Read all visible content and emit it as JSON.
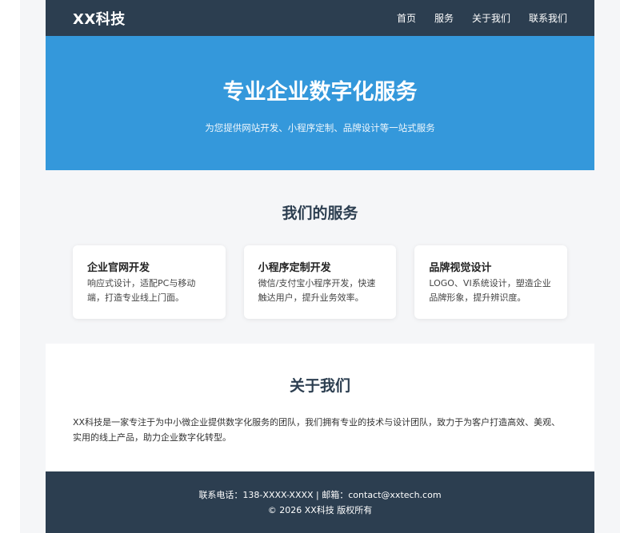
{
  "header": {
    "logo": "XX科技",
    "nav": [
      "首页",
      "服务",
      "关于我们",
      "联系我们"
    ]
  },
  "hero": {
    "title": "专业企业数字化服务",
    "subtitle": "为您提供网站开发、小程序定制、品牌设计等一站式服务"
  },
  "services": {
    "title": "我们的服务",
    "cards": [
      {
        "title": "企业官网开发",
        "desc": "响应式设计，适配PC与移动端，打造专业线上门面。"
      },
      {
        "title": "小程序定制开发",
        "desc": "微信/支付宝小程序开发，快速触达用户，提升业务效率。"
      },
      {
        "title": "品牌视觉设计",
        "desc": "LOGO、VI系统设计，塑造企业品牌形象，提升辨识度。"
      }
    ]
  },
  "about": {
    "title": "关于我们",
    "text": "XX科技是一家专注于为中小微企业提供数字化服务的团队，我们拥有专业的技术与设计团队，致力于为客户打造高效、美观、实用的线上产品，助力企业数字化转型。"
  },
  "footer": {
    "contact": "联系电话：138-XXXX-XXXX | 邮箱：contact@xxtech.com",
    "copyright": "© 2026 XX科技 版权所有"
  },
  "colors": {
    "header_bg": "#2c3e50",
    "hero_bg": "#3498db",
    "section_bg": "#f5f6f8",
    "footer_bg": "#2c3e50"
  }
}
